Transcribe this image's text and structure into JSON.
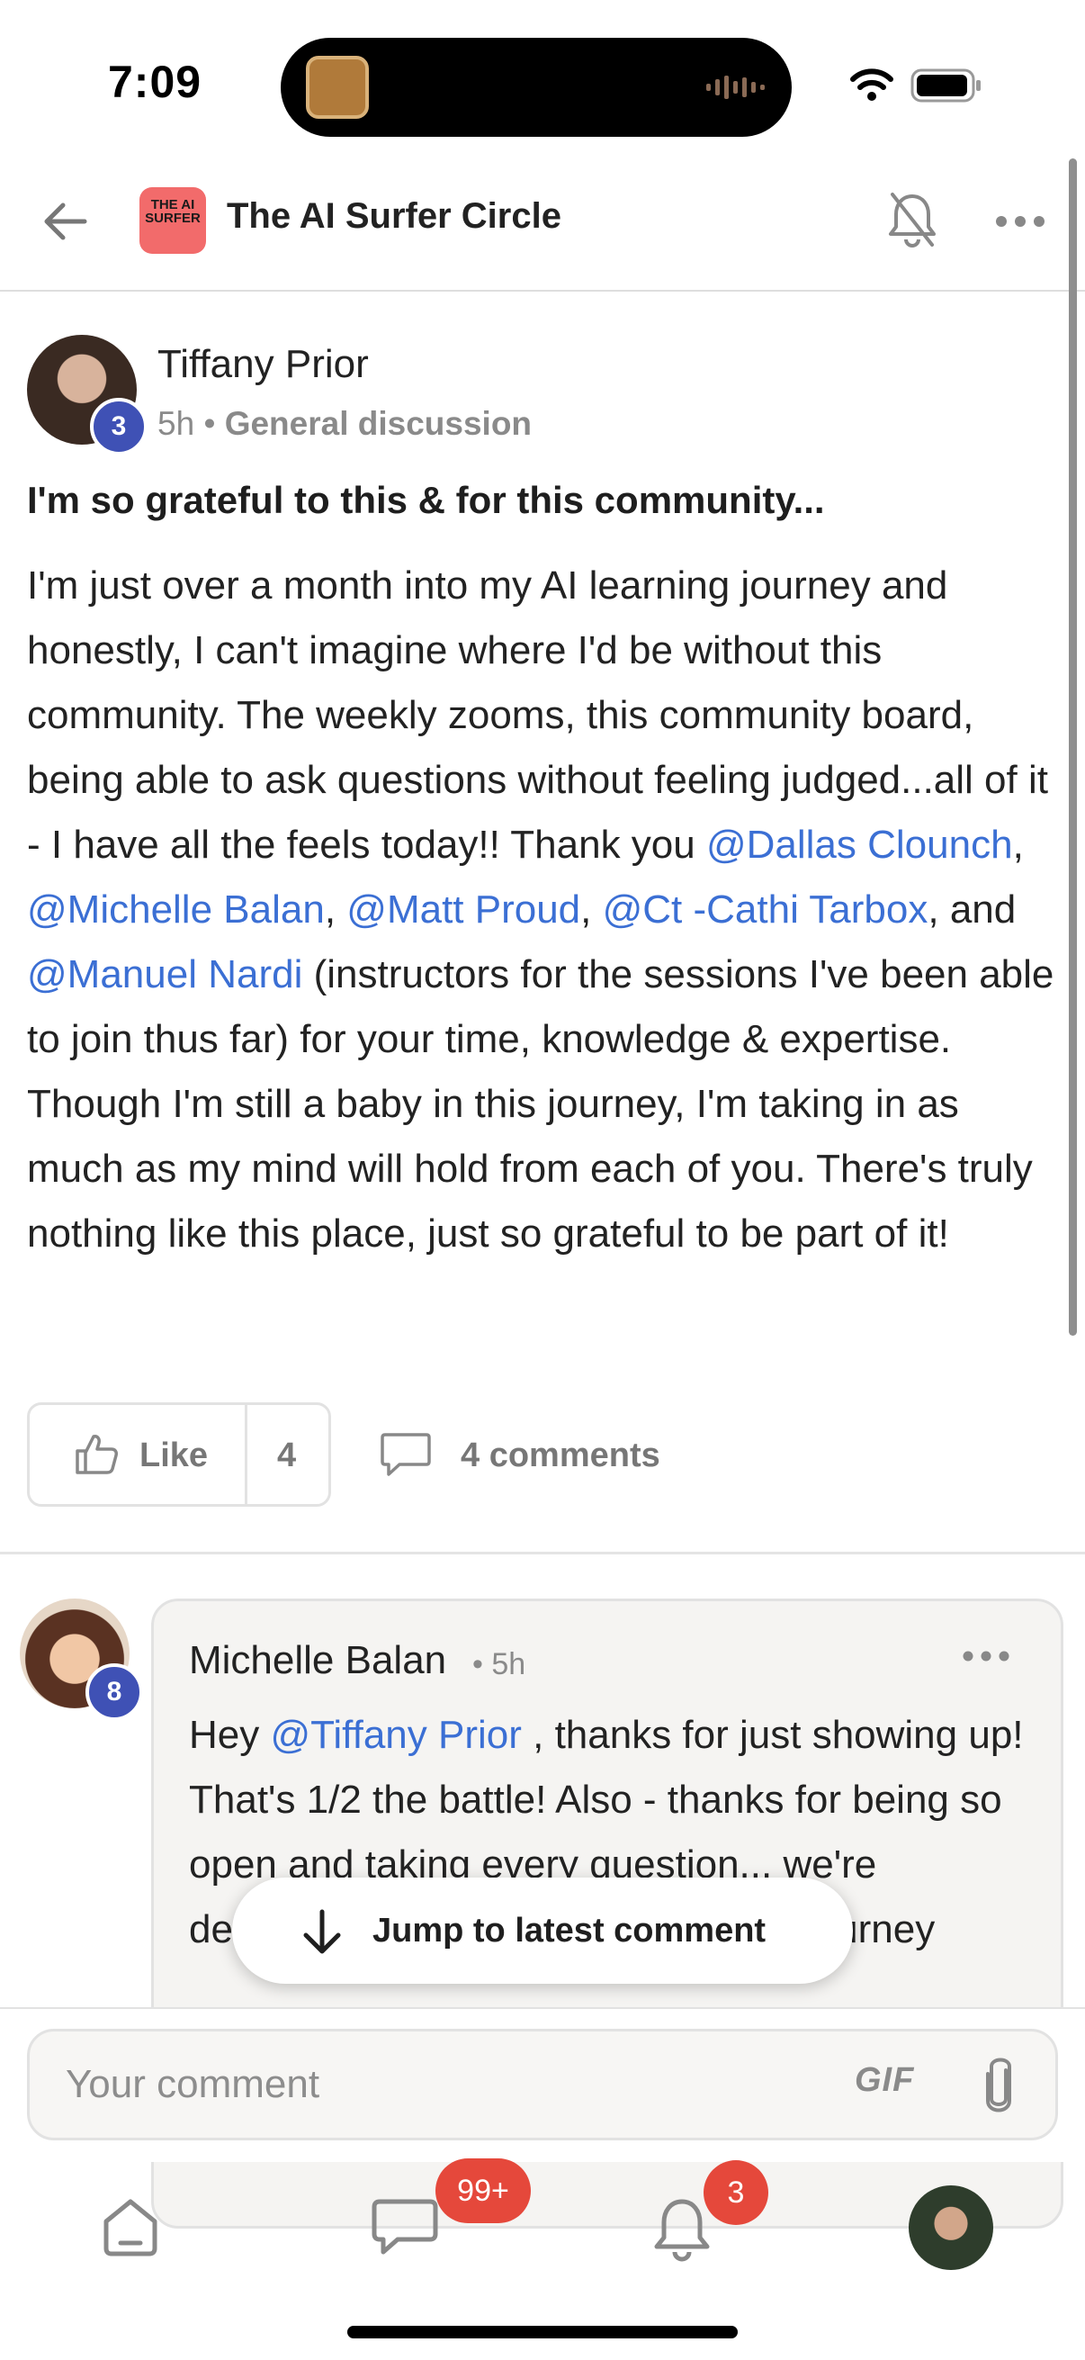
{
  "status_bar": {
    "time": "7:09"
  },
  "header": {
    "back_icon": "arrow-left-icon",
    "group_logo_text": "THE AI SURFER",
    "group_name": "The AI Surfer Circle",
    "mute_icon": "bell-off-icon",
    "more_icon": "ellipsis-icon"
  },
  "post": {
    "author": "Tiffany Prior",
    "level": "3",
    "time": "5h",
    "separator": "•",
    "category": "General discussion",
    "title": "I'm so grateful to this & for this community...",
    "body": {
      "p1": "I'm just over a month into my AI learning journey and honestly, I can't imagine where I'd be without this community. The weekly zooms, this community board, being able to ask questions without feeling judged...all of it - I have all the feels today!! Thank you ",
      "m1": "@Dallas Clounch",
      "s1": ", ",
      "m2": "@Michelle Balan",
      "s2": ", ",
      "m3": "@Matt Proud",
      "s3": ", ",
      "m4": "@Ct -Cathi Tarbox",
      "s4": ", and ",
      "m5": "@Manuel Nardi",
      "p2": " (instructors for the sessions I've been able to join thus far) for your time, knowledge & expertise. Though I'm still a baby in this journey, I'm taking in as much as my mind will hold from each of you. There's truly nothing like this place, just so grateful to be part of it!"
    },
    "like_label": "Like",
    "like_count": "4",
    "comments_label": "4 comments"
  },
  "comment": {
    "author": "Michelle Balan",
    "level": "8",
    "time": "• 5h",
    "body_pre": "Hey ",
    "mention": "@Tiffany Prior",
    "body_post": " , thanks for just showing up! That's 1/2 the battle! Also - thanks for being so open and taking every question... we're definitely here to go through our AI journey"
  },
  "jump_button": {
    "label": "Jump to latest comment"
  },
  "composer": {
    "placeholder": "Your comment",
    "gif_label": "GIF"
  },
  "tab_bar": {
    "chat_badge": "99+",
    "notifications_badge": "3"
  },
  "colors": {
    "mention": "#3b6fd4",
    "badge_level": "#3f51b5",
    "badge_alert": "#e5483b"
  }
}
